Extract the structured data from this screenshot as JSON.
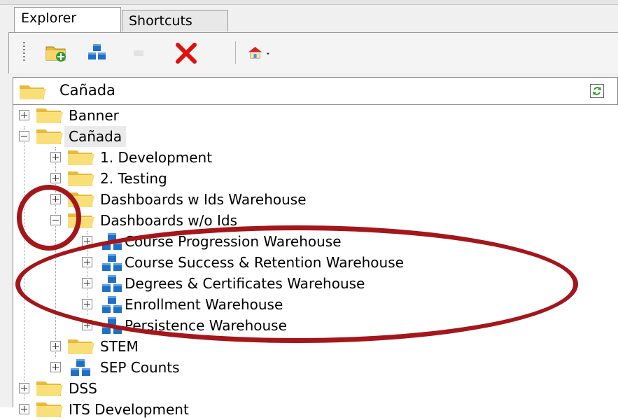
{
  "tabs": [
    {
      "label": "Explorer",
      "active": true
    },
    {
      "label": "Shortcuts",
      "active": false
    }
  ],
  "toolbar": {
    "buttons": [
      {
        "icon": "new-folder-icon",
        "enabled": true
      },
      {
        "icon": "new-warehouse-icon",
        "enabled": true
      },
      {
        "icon": "disabled-button-icon",
        "enabled": false
      },
      {
        "icon": "delete-icon",
        "enabled": true
      },
      {
        "icon": "home-icon",
        "enabled": true,
        "dropdown": true
      }
    ]
  },
  "path": {
    "current": "Cañada",
    "refresh_icon": "refresh-icon"
  },
  "tree": {
    "nodes": [
      {
        "id": "banner",
        "label": "Banner",
        "type": "folder",
        "expanded": false
      },
      {
        "id": "canada",
        "label": "Cañada",
        "type": "folder",
        "expanded": true,
        "selected": true
      },
      {
        "id": "development",
        "label": "1. Development",
        "type": "folder",
        "expanded": false
      },
      {
        "id": "testing",
        "label": "2. Testing",
        "type": "folder",
        "expanded": false
      },
      {
        "id": "dash-ids",
        "label": "Dashboards w Ids Warehouse",
        "type": "folder",
        "expanded": false
      },
      {
        "id": "dash-wo-ids",
        "label": "Dashboards w/o Ids",
        "type": "folder",
        "expanded": true
      },
      {
        "id": "course-progression",
        "label": "Course Progression Warehouse",
        "type": "warehouse",
        "expanded": false
      },
      {
        "id": "course-success",
        "label": "Course Success & Retention Warehouse",
        "type": "warehouse",
        "expanded": false
      },
      {
        "id": "degrees",
        "label": "Degrees & Certificates Warehouse",
        "type": "warehouse",
        "expanded": false
      },
      {
        "id": "enrollment",
        "label": "Enrollment Warehouse",
        "type": "warehouse",
        "expanded": false
      },
      {
        "id": "persistence",
        "label": "Persistence Warehouse",
        "type": "warehouse",
        "expanded": false
      },
      {
        "id": "stem",
        "label": "STEM",
        "type": "folder",
        "expanded": false
      },
      {
        "id": "sep-counts",
        "label": "SEP Counts",
        "type": "warehouse",
        "expanded": false
      },
      {
        "id": "dss",
        "label": "DSS",
        "type": "folder",
        "expanded": false
      },
      {
        "id": "its-dev",
        "label": "ITS Development",
        "type": "folder",
        "expanded": false
      }
    ]
  },
  "colors": {
    "annotation": "#a4161a",
    "folder": "#f6d66a",
    "warehouse": "#1f6fc5",
    "delete": "#e01010"
  }
}
